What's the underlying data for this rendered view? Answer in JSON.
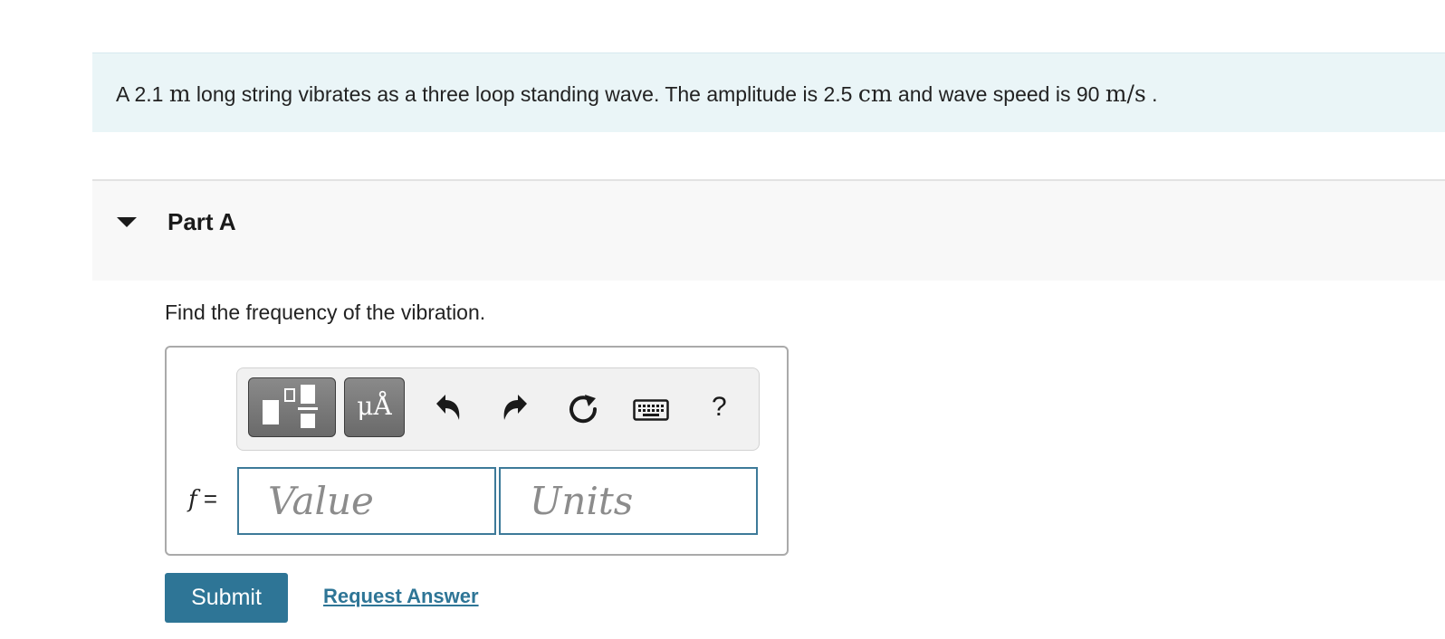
{
  "problem": {
    "t1": "A 2.1 ",
    "u1": "m",
    "t2": " long string vibrates as a three loop standing wave. The amplitude is 2.5 ",
    "u2": "cm",
    "t3": " and wave speed is 90 ",
    "u3": "m/s",
    "t4": " ."
  },
  "part": {
    "title": "Part A",
    "question": "Find the frequency of the vibration."
  },
  "toolbar": {
    "units_button_label": "μÅ",
    "help_label": "?",
    "icons": [
      "templates-icon",
      "units-icon",
      "undo-icon",
      "redo-icon",
      "reset-icon",
      "keyboard-icon",
      "help-icon"
    ]
  },
  "answer": {
    "variable": "f",
    "equals": "=",
    "value_placeholder": "Value",
    "units_placeholder": "Units",
    "value": "",
    "units": ""
  },
  "actions": {
    "submit_label": "Submit",
    "request_label": "Request Answer"
  },
  "colors": {
    "problem_bg": "#eaf5f7",
    "part_header_bg": "#f8f8f8",
    "accent": "#2e7596",
    "input_border": "#3d7a99"
  }
}
